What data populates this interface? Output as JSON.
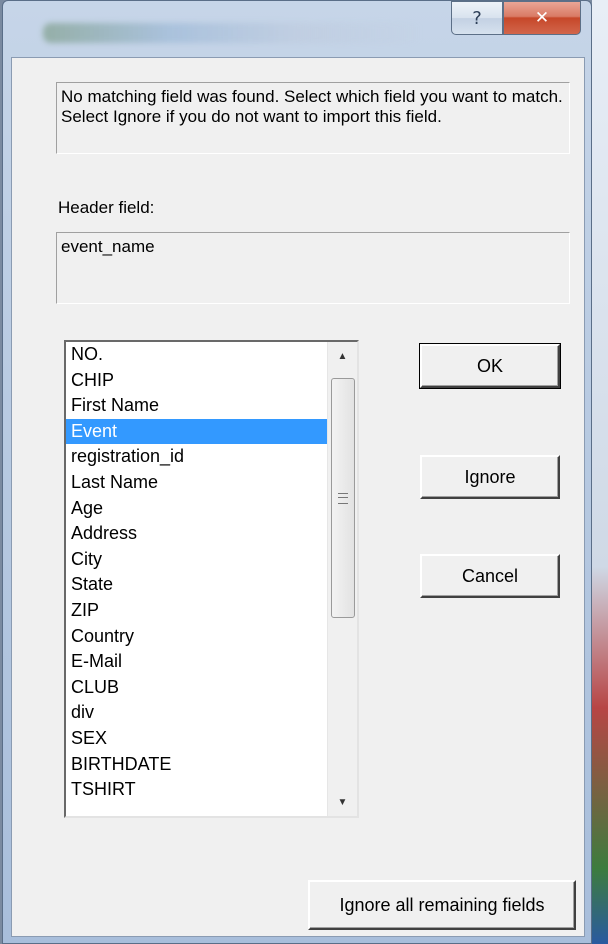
{
  "titlebar": {
    "help_glyph": "?",
    "close_glyph": "✕"
  },
  "message": "No matching field was found.  Select which field you want to match.  Select Ignore if you do not want to import this field.",
  "header_field": {
    "label": "Header field:",
    "value": "event_name"
  },
  "fields_list": {
    "items": [
      "NO.",
      "CHIP",
      "First Name",
      "Event",
      "registration_id",
      "Last Name",
      "Age",
      "Address",
      "City",
      "State",
      "ZIP",
      "Country",
      "E-Mail",
      "CLUB",
      "div",
      "SEX",
      "BIRTHDATE",
      "TSHIRT"
    ],
    "selected": "Event"
  },
  "buttons": {
    "ok": "OK",
    "ignore": "Ignore",
    "cancel": "Cancel",
    "ignore_all": "Ignore all remaining fields"
  },
  "colors": {
    "selection": "#3399ff",
    "dialog_bg": "#f0f0f0",
    "close_button": "#c6472a"
  }
}
